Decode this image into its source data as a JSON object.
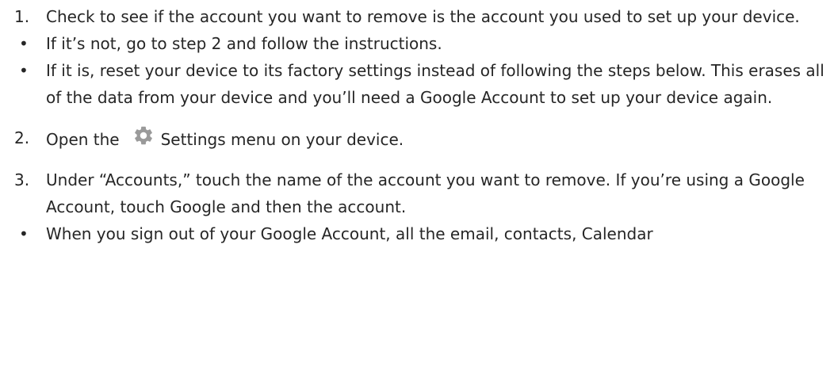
{
  "steps": [
    {
      "marker": "1.",
      "text": "Check to see if the account you want to remove is the account you used to set up your device."
    },
    {
      "marker": "•",
      "text": "If it’s not, go to step 2 and follow the instructions."
    },
    {
      "marker": "•",
      "text": "If it is, reset your device to its factory settings instead of following the steps below. This erases all of the data from your device and you’ll need a Google Account to set up your device again."
    },
    {
      "marker": "2.",
      "text_before": "Open the",
      "icon": "gear-icon",
      "text_after": "Settings menu on your device."
    },
    {
      "marker": "3.",
      "text": "Under “Accounts,” touch the name of the account you want to remove. If you’re using a Google Account, touch Google and then the account."
    },
    {
      "marker": "•",
      "text": "When you sign out of your Google Account, all the email, contacts, Calendar"
    }
  ],
  "colors": {
    "text": "#262626",
    "icon": "#9a9a9a"
  }
}
